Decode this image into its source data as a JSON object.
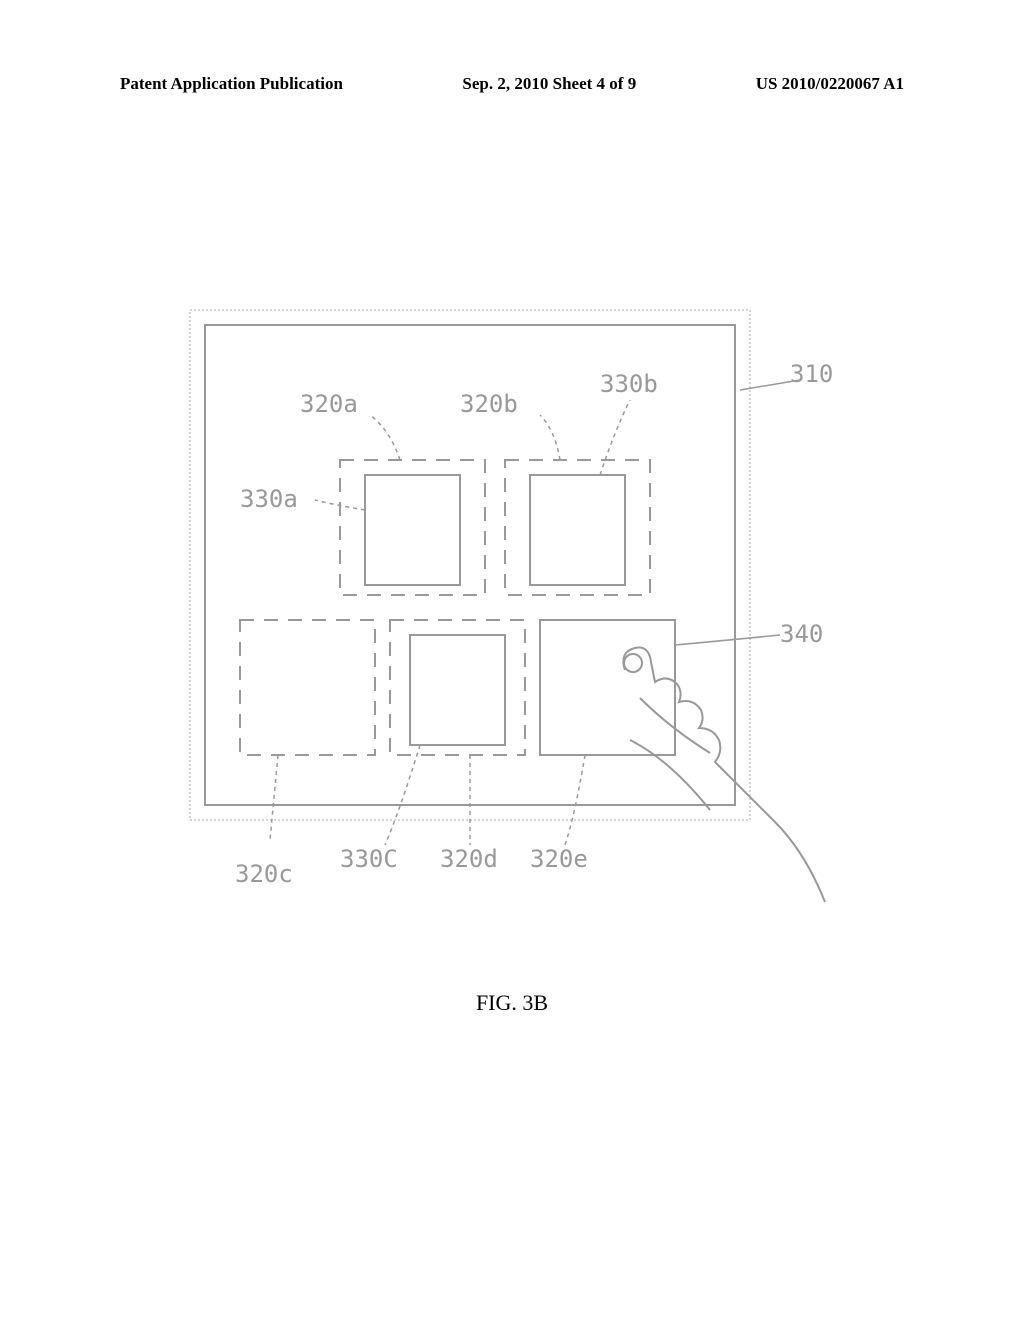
{
  "header": {
    "left": "Patent Application Publication",
    "center": "Sep. 2, 2010  Sheet 4 of 9",
    "right": "US 2010/0220067 A1"
  },
  "labels": {
    "l310": "310",
    "l320a": "320a",
    "l320b": "320b",
    "l320c": "320c",
    "l320d": "320d",
    "l320e": "320e",
    "l330a": "330a",
    "l330b": "330b",
    "l330c": "330C",
    "l340": "340"
  },
  "caption": "FIG. 3B"
}
